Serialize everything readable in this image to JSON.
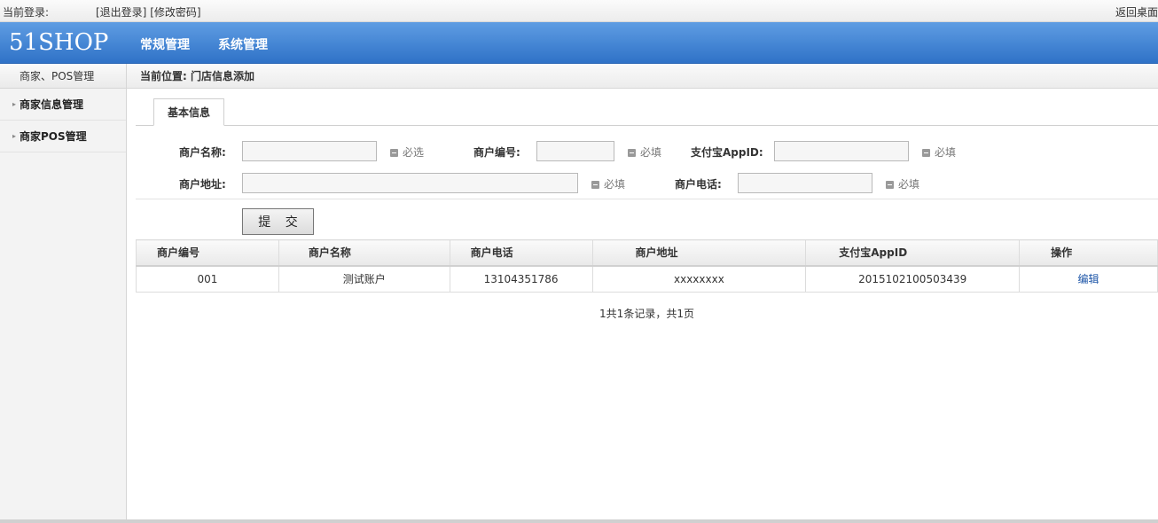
{
  "topbar": {
    "current_login_label": "当前登录:",
    "logout_link": "[退出登录]",
    "change_password_link": "[修改密码]",
    "back_desktop": "返回桌面"
  },
  "header": {
    "logo": "51SHOP",
    "nav": [
      "常规管理",
      "系统管理"
    ]
  },
  "sidebar": {
    "title": "商家、POS管理",
    "items": [
      {
        "label": "商家信息管理"
      },
      {
        "label": "商家POS管理"
      }
    ]
  },
  "breadcrumb": "当前位置: 门店信息添加",
  "tabs": [
    {
      "label": "基本信息"
    }
  ],
  "form": {
    "merchant_name": {
      "label": "商户名称:",
      "value": "",
      "hint": "必选"
    },
    "merchant_code": {
      "label": "商户编号:",
      "value": "",
      "hint": "必填"
    },
    "alipay_appid": {
      "label": "支付宝AppID:",
      "value": "",
      "hint": "必填"
    },
    "merchant_address": {
      "label": "商户地址:",
      "value": "",
      "hint": "必填"
    },
    "merchant_phone": {
      "label": "商户电话:",
      "value": "",
      "hint": "必填"
    },
    "submit_label": "提 交"
  },
  "table": {
    "columns": [
      "商户编号",
      "商户名称",
      "商户电话",
      "商户地址",
      "支付宝AppID",
      "操作"
    ],
    "rows": [
      {
        "code": "001",
        "name": "测试账户",
        "phone": "13104351786",
        "address": "xxxxxxxx",
        "appid": "2015102100503439",
        "action": "编辑"
      }
    ]
  },
  "pagination": "1共1条记录，共1页"
}
